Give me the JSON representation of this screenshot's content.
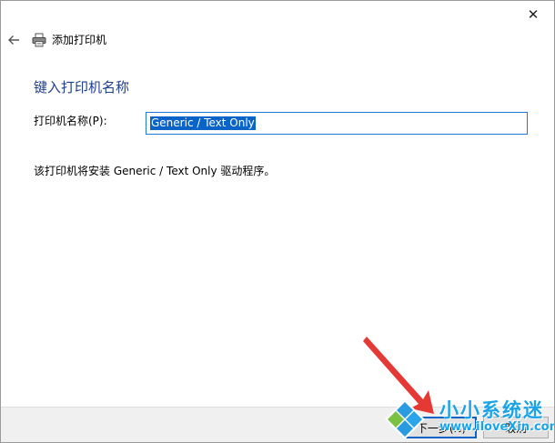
{
  "window": {
    "title": "添加打印机",
    "close_symbol": "✕",
    "back_icon": "back-arrow-icon",
    "title_icon": "printer-icon"
  },
  "main": {
    "heading": "键入打印机名称",
    "name_label": "打印机名称(P):",
    "name_value": "Generic / Text Only",
    "info": "该打印机将安装 Generic / Text Only 驱动程序。"
  },
  "footer": {
    "next_label": "下一步(N)",
    "cancel_label": "取消"
  },
  "watermark": {
    "title": "小小系统迷",
    "url": "www.iloveXin.com",
    "color": "#1aa3e8"
  },
  "colors": {
    "heading": "#1f3f8f",
    "accent": "#0a63c7",
    "arrow": "#e53935"
  }
}
